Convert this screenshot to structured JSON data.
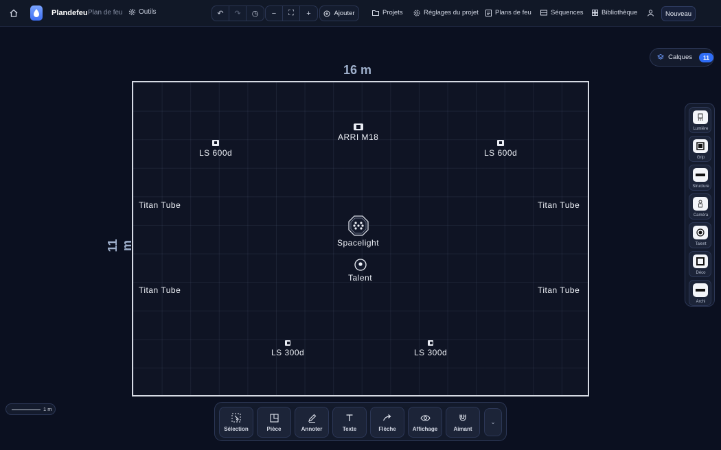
{
  "topbar": {
    "brand": "Plandefeu",
    "subtitle": "Plan de feu",
    "tools": "Outils",
    "add": "Ajouter",
    "menu": [
      {
        "label": "Projets",
        "icon": "folder-icon"
      },
      {
        "label": "Réglages du projet",
        "icon": "gear-icon"
      },
      {
        "label": "Plans de feu",
        "icon": "document-icon"
      },
      {
        "label": "Séquences",
        "icon": "film-icon"
      },
      {
        "label": "Bibliothèque",
        "icon": "grid-icon"
      }
    ],
    "new": "Nouveau"
  },
  "layers": {
    "label": "Calques",
    "count": "11"
  },
  "canvas": {
    "width_label": "16 m",
    "height_label": "11 m",
    "fixtures": [
      {
        "label": "ARRI M18",
        "type": "lamp-wide"
      },
      {
        "label": "LS 600d",
        "type": "lamp"
      },
      {
        "label": "LS 600d",
        "type": "lamp"
      },
      {
        "label": "Titan Tube",
        "type": "tube"
      },
      {
        "label": "Titan Tube",
        "type": "tube"
      },
      {
        "label": "Titan Tube",
        "type": "tube"
      },
      {
        "label": "Titan Tube",
        "type": "tube"
      },
      {
        "label": "Spacelight",
        "type": "spacelight"
      },
      {
        "label": "Talent",
        "type": "talent"
      },
      {
        "label": "LS 300d",
        "type": "lamp"
      },
      {
        "label": "LS 300d",
        "type": "lamp"
      }
    ]
  },
  "toolbox": [
    {
      "label": "Lumière",
      "icon": "light-icon"
    },
    {
      "label": "Grip",
      "icon": "grip-icon"
    },
    {
      "label": "Structure",
      "icon": "structure-icon"
    },
    {
      "label": "Caméra",
      "icon": "camera-icon"
    },
    {
      "label": "Talent",
      "icon": "talent-icon"
    },
    {
      "label": "Déco",
      "icon": "deco-icon"
    },
    {
      "label": "Archi",
      "icon": "archi-icon"
    }
  ],
  "scale": {
    "label": "1 m"
  },
  "bottombar": [
    {
      "label": "Sélection",
      "icon": "selection-icon"
    },
    {
      "label": "Pièce",
      "icon": "room-icon"
    },
    {
      "label": "Annoter",
      "icon": "pen-icon"
    },
    {
      "label": "Texte",
      "icon": "text-icon"
    },
    {
      "label": "Flèche",
      "icon": "arrow-icon"
    },
    {
      "label": "Affichage",
      "icon": "eye-icon"
    },
    {
      "label": "Aimant",
      "icon": "magnet-icon"
    }
  ],
  "colors": {
    "accent": "#2f6df6",
    "background": "#0b1020",
    "room_border": "#d7dbe4"
  }
}
